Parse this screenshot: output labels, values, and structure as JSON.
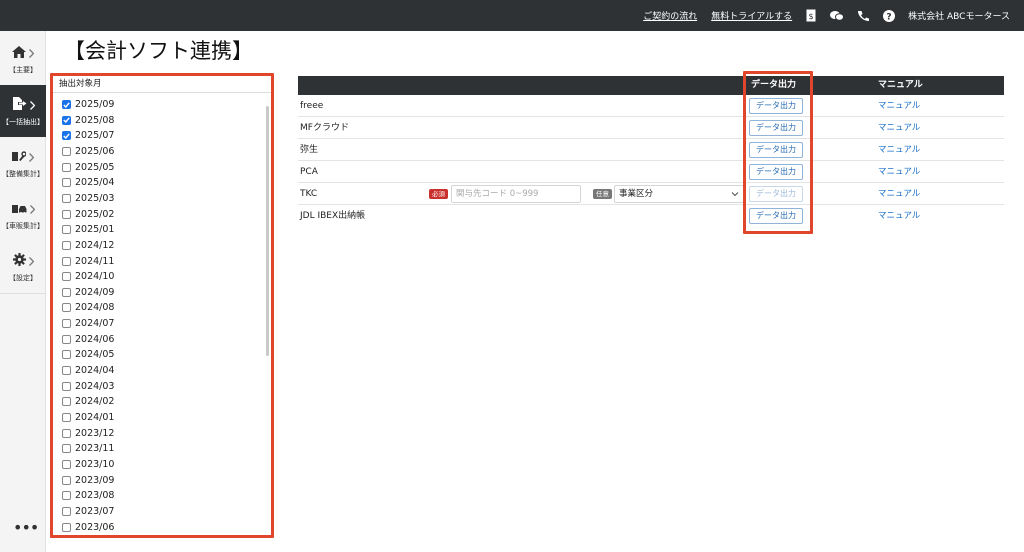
{
  "header": {
    "links": [
      "ご契約の流れ",
      "無料トライアルする"
    ],
    "icons": [
      "price-tag-icon",
      "chat-icon",
      "phone-icon",
      "help-icon"
    ],
    "company": "株式会社 ABCモータース"
  },
  "sidebar": {
    "items": [
      {
        "icon": "home-icon",
        "label": "【主要】",
        "active": false
      },
      {
        "icon": "export-icon",
        "label": "【一括抽出】",
        "active": true
      },
      {
        "icon": "wrench-icon",
        "label": "【整備集計】",
        "active": false
      },
      {
        "icon": "car-icon",
        "label": "【車販集計】",
        "active": false
      },
      {
        "icon": "gear-icon",
        "label": "【設定】",
        "active": false
      }
    ],
    "more": "•••"
  },
  "page": {
    "title": "【会計ソフト連携】"
  },
  "months": {
    "header": "抽出対象月",
    "items": [
      {
        "label": "2025/09",
        "checked": true
      },
      {
        "label": "2025/08",
        "checked": true
      },
      {
        "label": "2025/07",
        "checked": true
      },
      {
        "label": "2025/06",
        "checked": false
      },
      {
        "label": "2025/05",
        "checked": false
      },
      {
        "label": "2025/04",
        "checked": false
      },
      {
        "label": "2025/03",
        "checked": false
      },
      {
        "label": "2025/02",
        "checked": false
      },
      {
        "label": "2025/01",
        "checked": false
      },
      {
        "label": "2024/12",
        "checked": false
      },
      {
        "label": "2024/11",
        "checked": false
      },
      {
        "label": "2024/10",
        "checked": false
      },
      {
        "label": "2024/09",
        "checked": false
      },
      {
        "label": "2024/08",
        "checked": false
      },
      {
        "label": "2024/07",
        "checked": false
      },
      {
        "label": "2024/06",
        "checked": false
      },
      {
        "label": "2024/05",
        "checked": false
      },
      {
        "label": "2024/04",
        "checked": false
      },
      {
        "label": "2024/03",
        "checked": false
      },
      {
        "label": "2024/02",
        "checked": false
      },
      {
        "label": "2024/01",
        "checked": false
      },
      {
        "label": "2023/12",
        "checked": false
      },
      {
        "label": "2023/11",
        "checked": false
      },
      {
        "label": "2023/10",
        "checked": false
      },
      {
        "label": "2023/09",
        "checked": false
      },
      {
        "label": "2023/08",
        "checked": false
      },
      {
        "label": "2023/07",
        "checked": false
      },
      {
        "label": "2023/06",
        "checked": false
      }
    ]
  },
  "table": {
    "col_output": "データ出力",
    "col_manual": "マニュアル",
    "rows": [
      {
        "name": "freee",
        "button": "データ出力",
        "manual": "マニュアル",
        "disabled": false
      },
      {
        "name": "MFクラウド",
        "button": "データ出力",
        "manual": "マニュアル",
        "disabled": false
      },
      {
        "name": "弥生",
        "button": "データ出力",
        "manual": "マニュアル",
        "disabled": false
      },
      {
        "name": "PCA",
        "button": "データ出力",
        "manual": "マニュアル",
        "disabled": false
      },
      {
        "name": "TKC",
        "button": "データ出力",
        "manual": "マニュアル",
        "disabled": true
      },
      {
        "name": "JDL IBEX出納帳",
        "button": "データ出力",
        "manual": "マニュアル",
        "disabled": false
      }
    ],
    "tkc": {
      "required_badge": "必須",
      "code_placeholder": "関与先コード 0~999",
      "optional_badge": "任意",
      "select_value": "事業区分"
    }
  },
  "colors": {
    "topbar": "#2f3235",
    "highlight": "#e0462c",
    "link": "#1a6fc7",
    "checkbox": "#1a73e8"
  }
}
